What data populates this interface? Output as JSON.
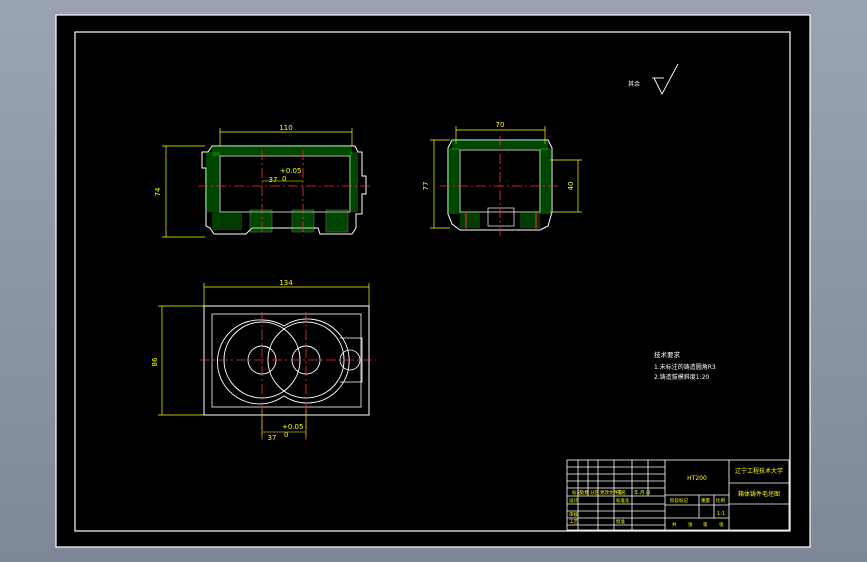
{
  "drawing": {
    "title": "HT200",
    "university": "辽宁工程技术大学",
    "part_name": "箱体铸件毛坯图",
    "scale": "1:1"
  },
  "surface_note": "其余",
  "tech_requirements": {
    "heading": "技术要求",
    "items": [
      "1.未标注的铸造圆角R3",
      "2.铸造拔模斜度1:20"
    ]
  },
  "dimensions": {
    "front_width": "110",
    "front_height": "74",
    "front_center": "37",
    "front_tol": "+0.05",
    "front_tol2": "0",
    "side_width": "70",
    "side_height": "77",
    "side_hole": "40",
    "top_width": "134",
    "top_height": "86",
    "top_center": "37",
    "top_tol": "+0.05",
    "top_tol2": "0"
  },
  "title_block": {
    "row_labels": [
      "标记",
      "处数",
      "分区",
      "更改文件号",
      "签名",
      "年.月.日"
    ],
    "left_labels": [
      "设计",
      "审核",
      "工艺"
    ],
    "mid_labels": [
      "标准化",
      "批准"
    ],
    "stage_labels": [
      "阶段标记",
      "重量",
      "比例"
    ],
    "sheet_labels": [
      "共",
      "张",
      "第",
      "张"
    ]
  }
}
